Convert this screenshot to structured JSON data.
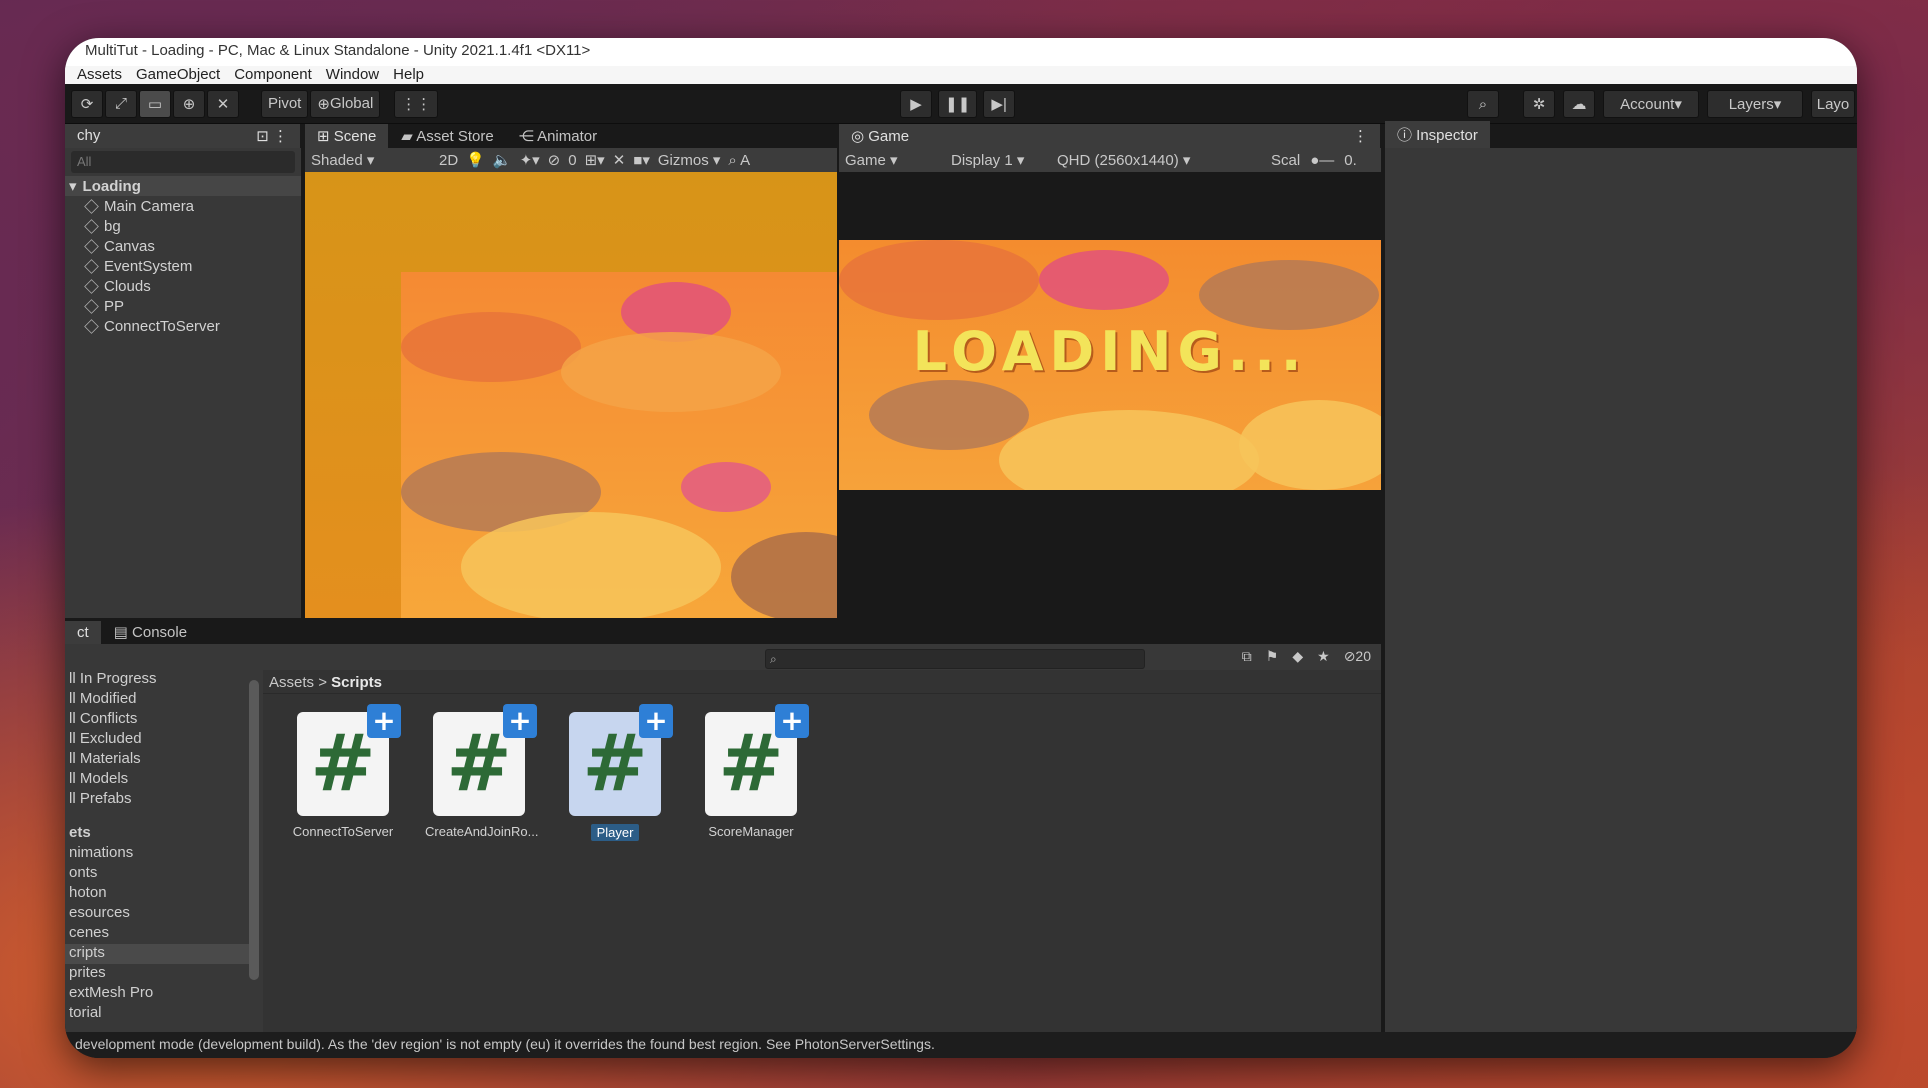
{
  "window": {
    "title": "MultiTut - Loading - PC, Mac & Linux Standalone - Unity 2021.1.4f1 <DX11>"
  },
  "menu": [
    "Assets",
    "GameObject",
    "Component",
    "Window",
    "Help"
  ],
  "toolbar": {
    "pivot_label": "Pivot",
    "global_label": "Global",
    "account_label": "Account",
    "layers_label": "Layers",
    "layout_label": "Layo"
  },
  "hierarchy": {
    "tab_label": "chy",
    "search_placeholder": "All",
    "scene": "Loading",
    "items": [
      "Main Camera",
      "bg",
      "Canvas",
      "EventSystem",
      "Clouds",
      "PP",
      "ConnectToServer"
    ]
  },
  "scene_tabs": [
    "Scene",
    "Asset Store",
    "Animator"
  ],
  "scene_toolbar": {
    "shading": "Shaded",
    "mode_2d": "2D",
    "hidden_count": "0",
    "gizmos": "Gizmos",
    "search": "A"
  },
  "game": {
    "tab_label": "Game",
    "view_label": "Game",
    "display": "Display 1",
    "resolution": "QHD (2560x1440)",
    "scale_label": "Scal",
    "scale_value": "0.",
    "loading_text": "LOADING..."
  },
  "inspector": {
    "tab_label": "Inspector"
  },
  "project": {
    "tab_label": "ct",
    "console_label": "Console",
    "hidden_count": "20",
    "favorites": [
      "ll In Progress",
      "ll Modified",
      "ll Conflicts",
      "ll Excluded",
      "ll Materials",
      "ll Models",
      "ll Prefabs"
    ],
    "assets_head": "ets",
    "folders": [
      "nimations",
      "onts",
      "hoton",
      "esources",
      "cenes",
      "cripts",
      "prites",
      "extMesh Pro",
      "torial"
    ],
    "breadcrumb_root": "Assets",
    "breadcrumb_current": "Scripts",
    "assets": [
      {
        "name": "ConnectToServer",
        "selected": false
      },
      {
        "name": "CreateAndJoinRo...",
        "selected": false
      },
      {
        "name": "Player",
        "selected": true
      },
      {
        "name": "ScoreManager",
        "selected": false
      }
    ],
    "asset_glyph": "#",
    "asset_badge": "+"
  },
  "status": {
    "message": "development mode (development build). As the 'dev region' is not empty (eu) it overrides the found best region. See PhotonServerSettings."
  }
}
